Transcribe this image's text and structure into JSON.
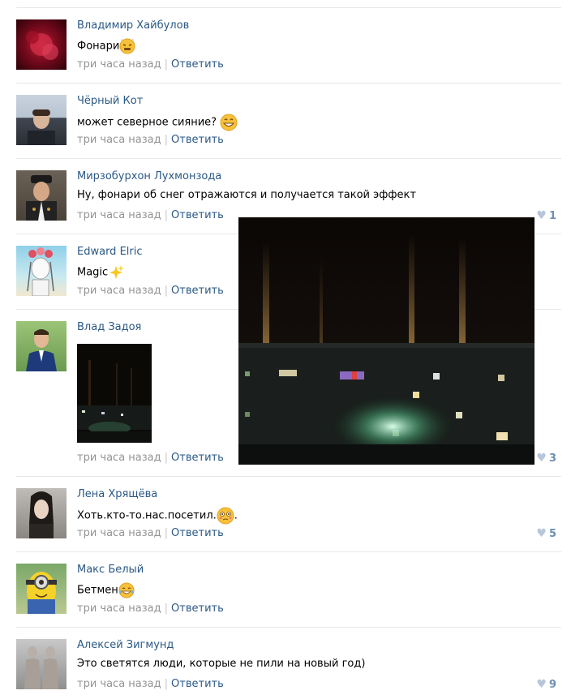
{
  "comments": [
    {
      "author": "Владимир Хайбулов",
      "text": "Фонари",
      "time": "три часа назад",
      "reply": "Ответить",
      "likes": ""
    },
    {
      "author": "Чёрный Кот",
      "text": "может северное сияние?",
      "time": "три часа назад",
      "reply": "Ответить",
      "likes": ""
    },
    {
      "author": "Мирзобурхон Лухмонзода",
      "text": "Ну, фонари об снег отражаются и получается такой эффект",
      "time": "три часа назад",
      "reply": "Ответить",
      "likes": "1"
    },
    {
      "author": "Edward Elric",
      "text": "Magic",
      "time": "три часа назад",
      "reply": "Ответить",
      "likes": ""
    },
    {
      "author": "Влад Задоя",
      "text": "",
      "time": "три часа назад",
      "reply": "Ответить",
      "likes": "3"
    },
    {
      "author": "Лена Хрящёва",
      "text": "Хоть.кто-то.нас.посетил.",
      "text_suffix": ".",
      "time": "три часа назад",
      "reply": "Ответить",
      "likes": "5"
    },
    {
      "author": "Макс Белый",
      "text": "Бетмен",
      "time": "три часа назад",
      "reply": "Ответить",
      "likes": ""
    },
    {
      "author": "Алексей Зигмунд",
      "text": "Это светятся люди, которые не пили на новый год)",
      "time": "три часа назад",
      "reply": "Ответить",
      "likes": "9"
    }
  ],
  "colors": {
    "link": "#2a5885",
    "meta": "#939393",
    "like": "#6d8fb3",
    "divider": "#e7e8ec"
  },
  "icons": [
    "heart-icon",
    "emoji-steam-face",
    "emoji-grin",
    "emoji-sparkles",
    "emoji-flushed",
    "emoji-tears-of-joy"
  ]
}
